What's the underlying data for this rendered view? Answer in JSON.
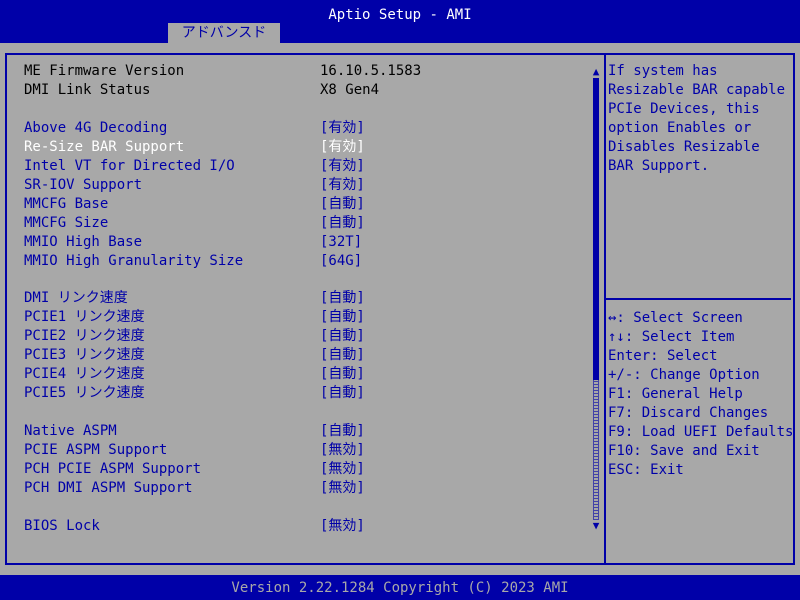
{
  "header": {
    "title": "Aptio Setup - AMI",
    "active_tab": "アドバンスド"
  },
  "info_rows": [
    {
      "label": "ME Firmware Version",
      "value": "16.10.5.1583"
    },
    {
      "label": "DMI Link Status",
      "value": "X8  Gen4"
    }
  ],
  "settings": [
    {
      "label": "Above 4G Decoding",
      "value": "[有効]"
    },
    {
      "label": "Re-Size BAR Support",
      "value": "[有効]",
      "selected": true
    },
    {
      "label": "Intel VT for Directed I/O",
      "value": "[有効]"
    },
    {
      "label": "SR-IOV Support",
      "value": "[有効]"
    },
    {
      "label": "MMCFG Base",
      "value": "[自動]"
    },
    {
      "label": "MMCFG Size",
      "value": "[自動]"
    },
    {
      "label": "MMIO High Base",
      "value": "[32T]"
    },
    {
      "label": "MMIO High Granularity Size",
      "value": "[64G]"
    },
    {
      "label": "DMI リンク速度",
      "value": "[自動]"
    },
    {
      "label": "PCIE1 リンク速度",
      "value": "[自動]"
    },
    {
      "label": "PCIE2 リンク速度",
      "value": "[自動]"
    },
    {
      "label": "PCIE3 リンク速度",
      "value": "[自動]"
    },
    {
      "label": "PCIE4 リンク速度",
      "value": "[自動]"
    },
    {
      "label": "PCIE5 リンク速度",
      "value": "[自動]"
    },
    {
      "label": "Native ASPM",
      "value": "[自動]"
    },
    {
      "label": "PCIE ASPM Support",
      "value": "[無効]"
    },
    {
      "label": "PCH PCIE ASPM Support",
      "value": "[無効]"
    },
    {
      "label": "PCH DMI ASPM Support",
      "value": "[無効]"
    },
    {
      "label": "BIOS Lock",
      "value": "[無効]"
    }
  ],
  "scrollbar": {
    "up_arrow": "▲",
    "down_arrow": "▼",
    "position_fraction": 0.0
  },
  "help": {
    "lines": [
      "If system has",
      "Resizable BAR capable",
      "PCIe Devices, this",
      "option Enables or",
      "Disables Resizable",
      "BAR Support."
    ]
  },
  "key_help": [
    "↔: Select Screen",
    "↑↓: Select Item",
    "Enter: Select",
    "+/-: Change Option",
    "F1: General Help",
    "F7: Discard Changes",
    "F9: Load UEFI Defaults",
    "F10: Save and Exit",
    "ESC: Exit"
  ],
  "footer": {
    "version": "Version 2.22.1284 Copyright (C) 2023 AMI"
  },
  "colors": {
    "background": "#a8a8a8",
    "accent": "#0000a8",
    "highlight": "#ffffff"
  }
}
